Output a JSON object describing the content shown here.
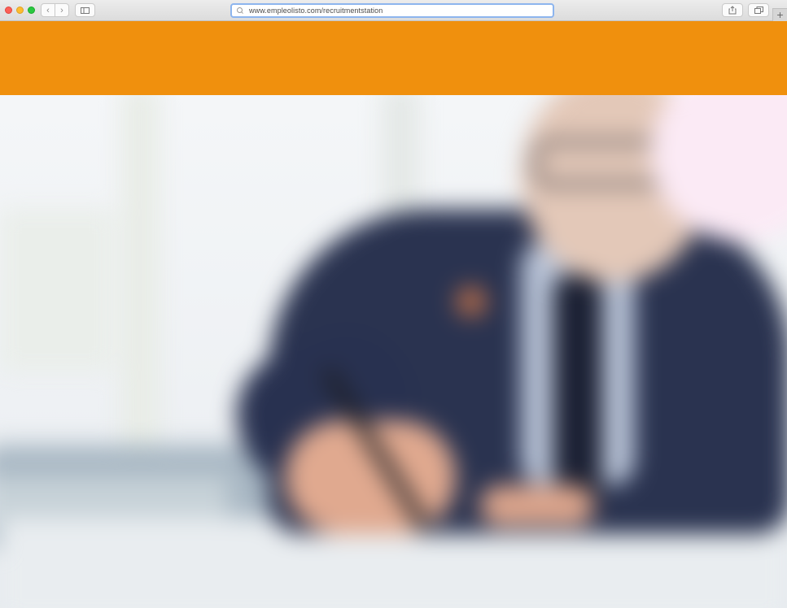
{
  "browser": {
    "url": "www.empleolisto.com/recruitmentstation",
    "buttons": {
      "back": "‹",
      "forward": "›",
      "sidebar": "▯▯",
      "share": "⇪",
      "tabs": "❐",
      "new_tab": "+"
    }
  },
  "colors": {
    "header_orange": "#f0900d",
    "address_focus": "#8db5ee"
  },
  "hero": {
    "image_alt": ""
  }
}
